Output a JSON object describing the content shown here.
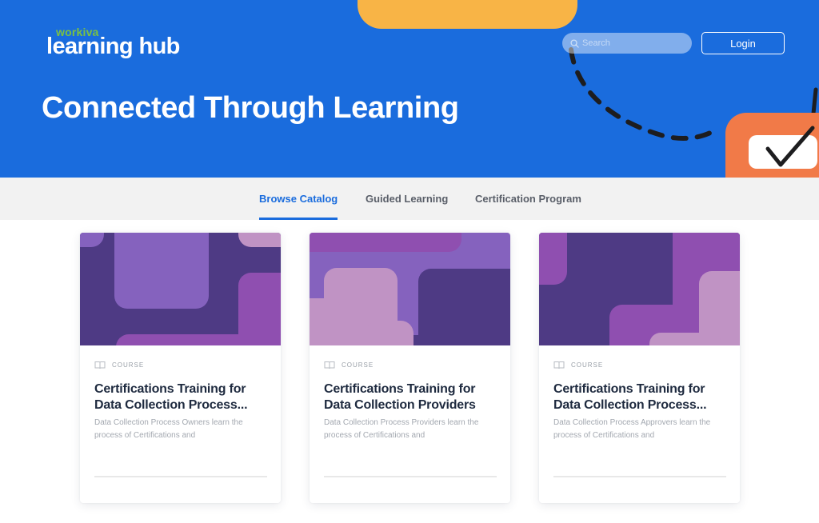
{
  "header": {
    "logo_brand": "workiva",
    "logo_main": "learning hub",
    "search_placeholder": "Search",
    "search_value": "",
    "login_label": "Login",
    "headline": "Connected Through Learning"
  },
  "colors": {
    "hero_blue": "#1a6cdd",
    "accent_yellow": "#f8b446",
    "accent_orange": "#f17a48",
    "brand_green": "#7ac143",
    "nav_bg": "#f2f2f2",
    "title_navy": "#1e2a3f"
  },
  "nav": {
    "tabs": [
      {
        "label": "Browse Catalog",
        "active": true
      },
      {
        "label": "Guided Learning",
        "active": false
      },
      {
        "label": "Certification Program",
        "active": false
      }
    ]
  },
  "cards": [
    {
      "type_icon": "book-icon",
      "type_label": "COURSE",
      "title": "Certifications Training for Data Collection Process...",
      "description": "Data Collection Process Owners learn the process of Certifications and"
    },
    {
      "type_icon": "book-icon",
      "type_label": "COURSE",
      "title": "Certifications Training for Data Collection Providers",
      "description": "Data Collection Process Providers learn the process of Certifications and"
    },
    {
      "type_icon": "book-icon",
      "type_label": "COURSE",
      "title": "Certifications Training for Data Collection Process...",
      "description": "Data Collection Process Approvers learn the process of Certifications and"
    }
  ]
}
